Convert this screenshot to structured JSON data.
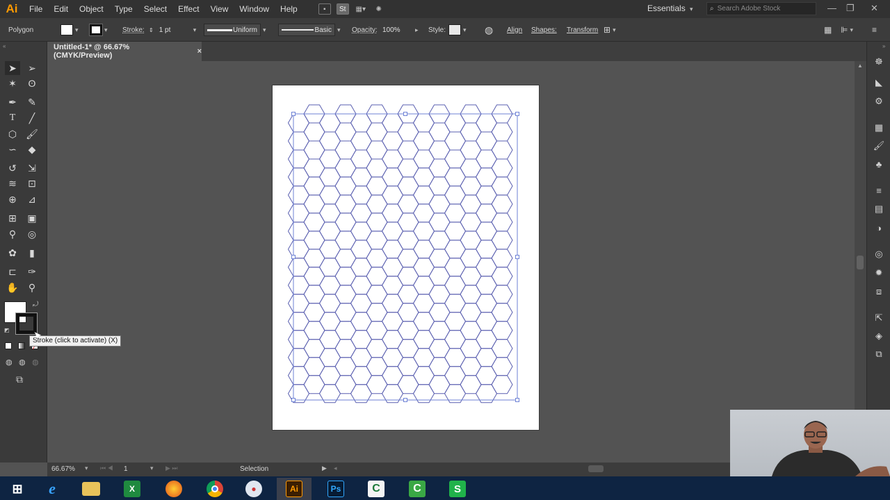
{
  "app": {
    "logo": "Ai",
    "brand_color": "#FF9A00"
  },
  "menu": [
    "File",
    "Edit",
    "Object",
    "Type",
    "Select",
    "Effect",
    "View",
    "Window",
    "Help"
  ],
  "menubar_icons": [
    "bridge-icon",
    "stock-icon",
    "arrange-documents-icon",
    "gpu-performance-icon"
  ],
  "workspace": {
    "label": "Essentials"
  },
  "search": {
    "placeholder": "Search Adobe Stock"
  },
  "control_bar": {
    "object_type": "Polygon",
    "fill_color": "#FFFFFF",
    "stroke_label": "Stroke:",
    "stroke_weight": "1 pt",
    "variable_width_profile": "Uniform",
    "brush_definition": "Basic",
    "opacity_label": "Opacity:",
    "opacity_value": "100%",
    "style_label": "Style:",
    "align_label": "Align",
    "shapes_label": "Shapes:",
    "transform_label": "Transform"
  },
  "document": {
    "tab_title": "Untitled-1* @ 66.67% (CMYK/Preview)",
    "close_glyph": "×"
  },
  "artwork": {
    "pattern": "hexagon grid",
    "stroke_color": "#5A5FB0",
    "selection_color": "#6E82D6"
  },
  "tools": [
    "selection-tool",
    "direct-selection-tool",
    "magic-wand-tool",
    "lasso-tool",
    "pen-tool",
    "curvature-tool",
    "type-tool",
    "line-tool",
    "ellipse-tool",
    "paintbrush-tool",
    "shaper-tool",
    "eraser-tool",
    "rotate-tool",
    "scale-tool",
    "warp-tool",
    "free-transform-tool",
    "shape-builder-tool",
    "perspective-grid-tool",
    "mesh-tool",
    "gradient-tool",
    "eyedropper-tool",
    "blend-tool",
    "symbol-sprayer-tool",
    "column-graph-tool",
    "artboard-tool",
    "slice-tool",
    "hand-tool",
    "zoom-tool"
  ],
  "tooltip": {
    "text": "Stroke (click to activate) (X)"
  },
  "status": {
    "zoom": "66.67%",
    "artboard_number": "1",
    "mode": "Selection"
  },
  "taskbar": [
    "windows-start",
    "internet-explorer",
    "file-explorer",
    "excel",
    "firefox",
    "chrome",
    "paint",
    "illustrator",
    "photoshop",
    "camtasia-recorder",
    "camtasia-studio",
    "sheets"
  ],
  "taskbar_labels": {
    "illustrator": "Ai",
    "photoshop": "Ps",
    "excel": "X",
    "sheets": "S",
    "camtasia-recorder": "C",
    "camtasia-studio": "C"
  }
}
